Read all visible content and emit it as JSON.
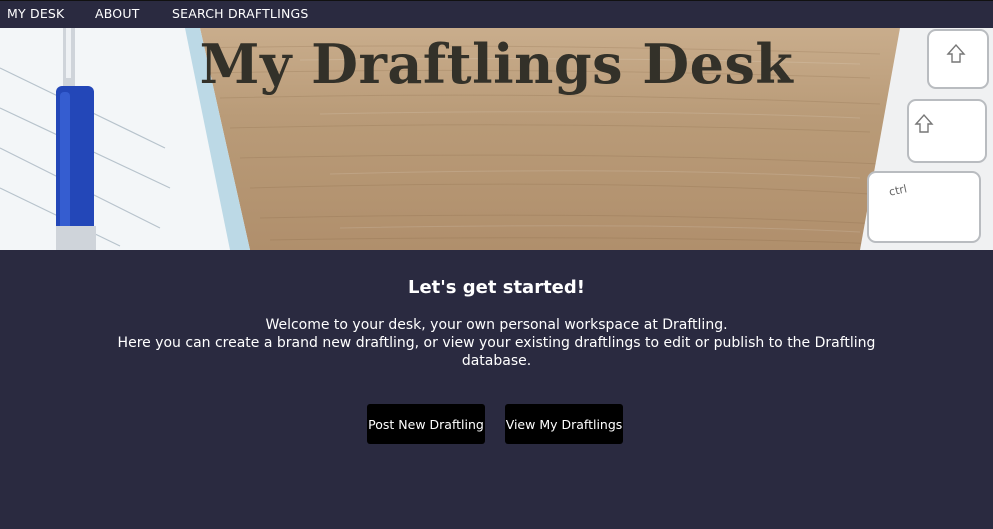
{
  "nav": {
    "items": [
      {
        "label": "MY DESK"
      },
      {
        "label": "ABOUT"
      },
      {
        "label": "SEARCH DRAFTLINGS"
      }
    ]
  },
  "hero": {
    "title": "My Draftlings Desk",
    "keyboard_key_label": "ctrl"
  },
  "main": {
    "heading": "Let's get started!",
    "intro_line1": "Welcome to your desk, your own personal workspace at Draftling.",
    "intro_line2": "Here you can create a brand new draftling, or view your existing draftlings to edit or publish to the Draftling database.",
    "post_button": "Post New Draftling",
    "view_button": "View My Draftlings"
  },
  "colors": {
    "background": "#2a2a40",
    "button": "#000000",
    "title_text": "#333129"
  }
}
